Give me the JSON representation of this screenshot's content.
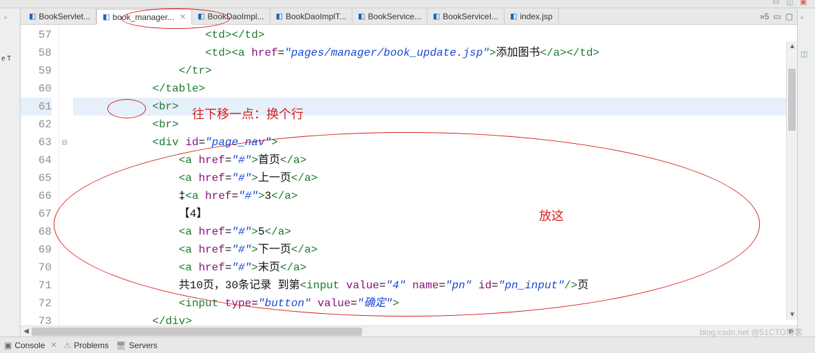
{
  "tabs": {
    "items": [
      {
        "label": "BookServlet..."
      },
      {
        "label": "book_manager..."
      },
      {
        "label": "BookDaoImpl..."
      },
      {
        "label": "BookDaoImplT..."
      },
      {
        "label": "BookService..."
      },
      {
        "label": "BookServiceI..."
      },
      {
        "label": "index.jsp"
      }
    ],
    "overflow": "»5"
  },
  "code": {
    "lines": [
      {
        "n": "57",
        "indent": "                    ",
        "html": "<span class='tag'>&lt;td&gt;&lt;/td&gt;</span>"
      },
      {
        "n": "58",
        "indent": "                    ",
        "html": "<span class='tag'>&lt;td&gt;&lt;a</span> <span class='attr'>href</span><span class='txt'>=</span><span class='val'>\"pages/manager/book_update.jsp\"</span><span class='tag'>&gt;</span><span class='txt'>添加图书</span><span class='tag'>&lt;/a&gt;&lt;/td&gt;</span>"
      },
      {
        "n": "59",
        "indent": "                ",
        "html": "<span class='tag'>&lt;/tr&gt;</span>"
      },
      {
        "n": "60",
        "indent": "            ",
        "html": "<span class='tag'>&lt;/table&gt;</span>"
      },
      {
        "n": "61",
        "indent": "            ",
        "html": "<span class='tag'>&lt;br&gt;</span>"
      },
      {
        "n": "62",
        "indent": "            ",
        "html": "<span class='tag'>&lt;br&gt;</span>"
      },
      {
        "n": "63",
        "indent": "            ",
        "html": "<span class='tag'>&lt;div</span> <span class='attr'>id</span><span class='txt'>=</span><span class='val'>\"page_nav\"</span><span class='tag'>&gt;</span>",
        "fold": "⊟"
      },
      {
        "n": "64",
        "indent": "                ",
        "html": "<span class='tag'>&lt;a</span> <span class='attr'>href</span><span class='txt'>=</span><span class='val'>\"#\"</span><span class='tag'>&gt;</span><span class='txt'>首页</span><span class='tag'>&lt;/a&gt;</span>"
      },
      {
        "n": "65",
        "indent": "                ",
        "html": "<span class='tag'>&lt;a</span> <span class='attr'>href</span><span class='txt'>=</span><span class='val'>\"#\"</span><span class='tag'>&gt;</span><span class='txt'>上一页</span><span class='tag'>&lt;/a&gt;</span>"
      },
      {
        "n": "66",
        "indent": "                ",
        "html": "<span class='tag'>&lt;a</span> <span class='attr'>href</span><span class='txt'>=</span><span class='val'>\"#\"</span><span class='tag'>&gt;</span><span class='txt'>3</span><span class='tag'>&lt;/a&gt;</span>",
        "caret": true
      },
      {
        "n": "67",
        "indent": "                ",
        "html": "<span class='txt'>【4】</span>"
      },
      {
        "n": "68",
        "indent": "                ",
        "html": "<span class='tag'>&lt;a</span> <span class='attr'>href</span><span class='txt'>=</span><span class='val'>\"#\"</span><span class='tag'>&gt;</span><span class='txt'>5</span><span class='tag'>&lt;/a&gt;</span>"
      },
      {
        "n": "69",
        "indent": "                ",
        "html": "<span class='tag'>&lt;a</span> <span class='attr'>href</span><span class='txt'>=</span><span class='val'>\"#\"</span><span class='tag'>&gt;</span><span class='txt'>下一页</span><span class='tag'>&lt;/a&gt;</span>"
      },
      {
        "n": "70",
        "indent": "                ",
        "html": "<span class='tag'>&lt;a</span> <span class='attr'>href</span><span class='txt'>=</span><span class='val'>\"#\"</span><span class='tag'>&gt;</span><span class='txt'>末页</span><span class='tag'>&lt;/a&gt;</span>"
      },
      {
        "n": "71",
        "indent": "                ",
        "html": "<span class='txt'>共</span><span class='txt'>10</span><span class='txt'>页，</span><span class='txt'>30</span><span class='txt'>条记录 到第</span><span class='tag'>&lt;input</span> <span class='attr'>value</span><span class='txt'>=</span><span class='val'>\"4\"</span> <span class='attr'>name</span><span class='txt'>=</span><span class='val'>\"pn\"</span> <span class='attr'>id</span><span class='txt'>=</span><span class='val'>\"pn_input\"</span><span class='tag'>/&gt;</span><span class='txt'>页</span>"
      },
      {
        "n": "72",
        "indent": "                ",
        "html": "<span class='tag'>&lt;input</span> <span class='attr'>type</span><span class='txt'>=</span><span class='val'>\"button\"</span> <span class='attr'>value</span><span class='txt'>=</span><span class='val'>\"确定\"</span><span class='tag'>&gt;</span>"
      },
      {
        "n": "73",
        "indent": "            ",
        "html": "<span class='tag'>&lt;/div&gt;</span>"
      }
    ],
    "highlight_line": "61"
  },
  "annotations": {
    "note1": "往下移一点：换个行",
    "note2": "放这"
  },
  "bottom": {
    "console": "Console",
    "problems": "Problems",
    "servers": "Servers"
  },
  "sidebar": {
    "left_label": "e T"
  },
  "watermark": "blog.csdn.net  @51CTO博客"
}
